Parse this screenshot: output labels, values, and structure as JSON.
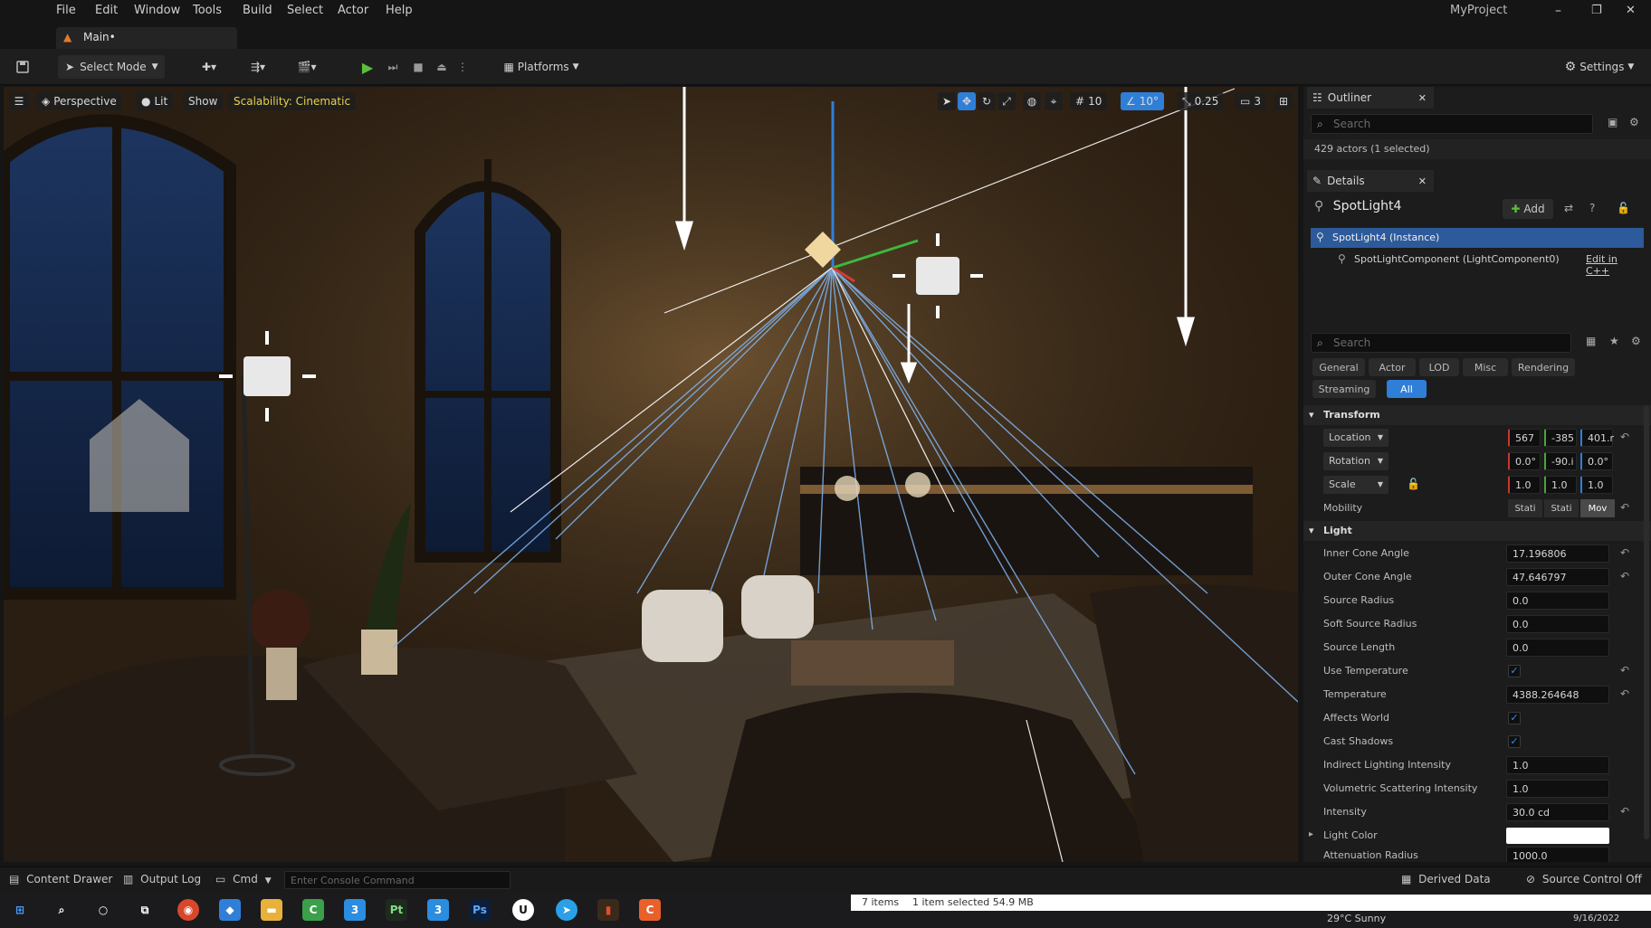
{
  "menu": [
    "File",
    "Edit",
    "Window",
    "Tools",
    "Build",
    "Select",
    "Actor",
    "Help"
  ],
  "project_name": "MyProject",
  "window_controls": {
    "minimize": "–",
    "maximize": "❐",
    "close": "✕"
  },
  "tab": {
    "label": "Main•"
  },
  "toolbar": {
    "select_mode": "Select Mode",
    "platforms": "Platforms",
    "settings": "Settings"
  },
  "viewport": {
    "perspective": "Perspective",
    "lit": "Lit",
    "show": "Show",
    "scalability": "Scalability: Cinematic",
    "snap_grid": "10",
    "snap_angle": "10°",
    "snap_scale": "0.25",
    "camera_speed": "3"
  },
  "outliner": {
    "title": "Outliner",
    "search_placeholder": "Search",
    "actor_count": "429 actors (1 selected)"
  },
  "details": {
    "title": "Details",
    "actor_name": "SpotLight4",
    "add_label": "Add",
    "instance": "SpotLight4 (Instance)",
    "component": "SpotLightComponent (LightComponent0)",
    "edit_cpp": "Edit in C++",
    "search_placeholder": "Search",
    "filters": [
      "General",
      "Actor",
      "LOD",
      "Misc",
      "Rendering"
    ],
    "filters2": [
      "Streaming",
      "All"
    ],
    "transform": {
      "section": "Transform",
      "location_label": "Location",
      "location": [
        "567",
        "-385",
        "401.r"
      ],
      "rotation_label": "Rotation",
      "rotation": [
        "0.0°",
        "-90.i",
        "0.0°"
      ],
      "scale_label": "Scale",
      "scale": [
        "1.0",
        "1.0",
        "1.0"
      ],
      "mobility_label": "Mobility",
      "mobility": [
        "Stati",
        "Stati",
        "Mov"
      ]
    },
    "light": {
      "section": "Light",
      "inner_cone_angle_label": "Inner Cone Angle",
      "inner_cone_angle": "17.196806",
      "outer_cone_angle_label": "Outer Cone Angle",
      "outer_cone_angle": "47.646797",
      "source_radius_label": "Source Radius",
      "source_radius": "0.0",
      "soft_source_radius_label": "Soft Source Radius",
      "soft_source_radius": "0.0",
      "source_length_label": "Source Length",
      "source_length": "0.0",
      "use_temperature_label": "Use Temperature",
      "temperature_label": "Temperature",
      "temperature": "4388.264648",
      "affects_world_label": "Affects World",
      "cast_shadows_label": "Cast Shadows",
      "indirect_label": "Indirect Lighting Intensity",
      "indirect": "1.0",
      "volumetric_label": "Volumetric Scattering Intensity",
      "volumetric": "1.0",
      "intensity_label": "Intensity",
      "intensity": "30.0 cd",
      "light_color_label": "Light Color",
      "attenuation_label": "Attenuation Radius",
      "attenuation": "1000.0"
    }
  },
  "statusbar": {
    "content_drawer": "Content Drawer",
    "output_log": "Output Log",
    "cmd": "Cmd",
    "console_placeholder": "Enter Console Command",
    "derived_data": "Derived Data",
    "source_control": "Source Control Off"
  },
  "taskbar": {
    "items_status": "7 items",
    "selected_status": "1 item selected  54.9 MB",
    "weather": "29°C  Sunny",
    "date": "9/16/2022"
  },
  "colors": {
    "accent": "#2f7fd8",
    "selected_row": "#2d5a9a",
    "play_green": "#5bbf3a",
    "scalability_text": "#e8d04a"
  }
}
